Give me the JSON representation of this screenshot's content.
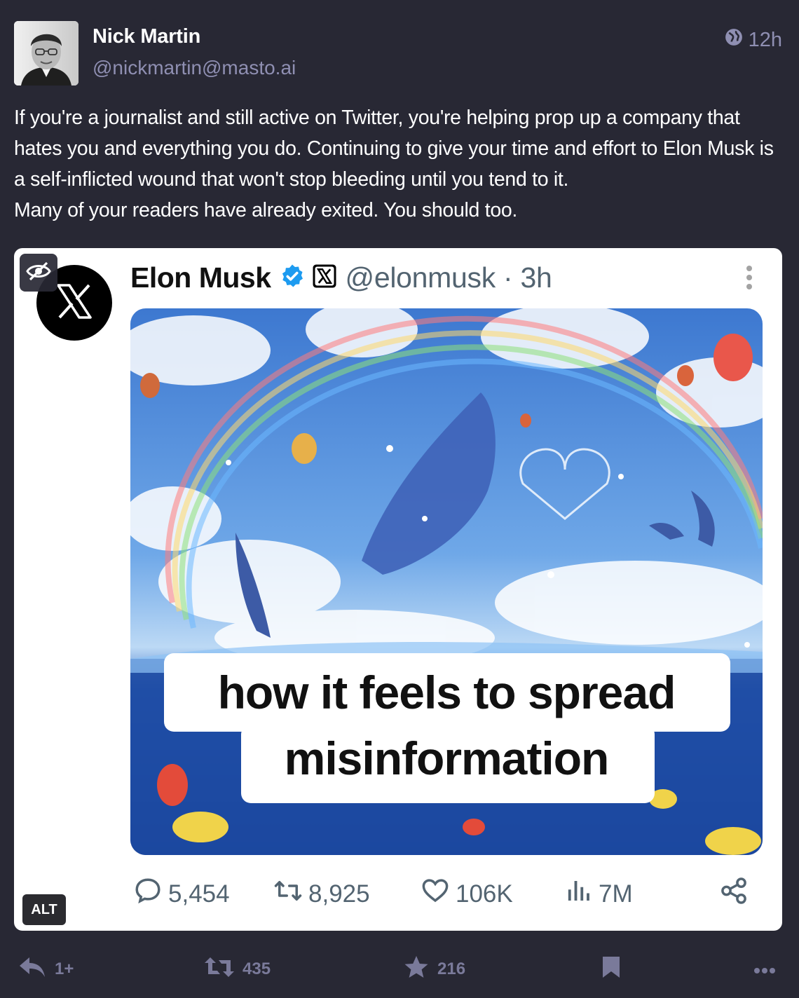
{
  "post": {
    "author_name": "Nick Martin",
    "author_handle": "@nickmartin@masto.ai",
    "timestamp": "12h",
    "visibility_icon": "globe-icon",
    "content": [
      "If you're a journalist and still active on Twitter, you're helping prop up a company that hates you and everything you do. Continuing to give your time and effort to Elon Musk is a self-inflicted wound that won't stop bleeding until you tend to it.",
      "Many of your readers have already exited. You should too."
    ]
  },
  "media": {
    "alt_label": "ALT",
    "tweet": {
      "name": "Elon Musk",
      "handle_time": "@elonmusk · 3h",
      "caption_line1": "how it feels to spread",
      "caption_line2": "misinformation",
      "replies": "5,454",
      "retweets": "8,925",
      "likes": "106K",
      "views": "7M"
    }
  },
  "actions": {
    "reply_count": "1+",
    "boost_count": "435",
    "favourite_count": "216"
  },
  "colors": {
    "background": "#282834",
    "muted": "#8f8fb2",
    "verified_blue": "#1d9bf0"
  }
}
